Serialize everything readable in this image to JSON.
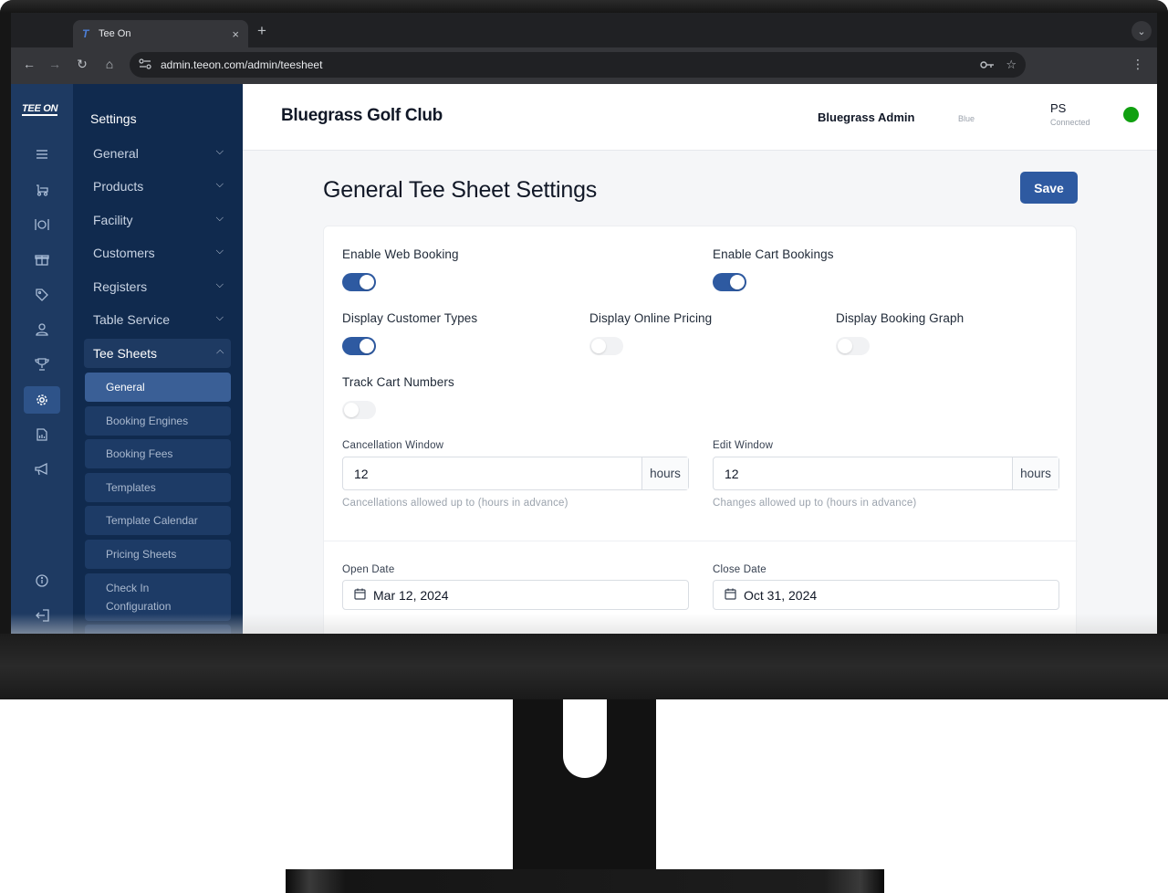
{
  "browser": {
    "tab_title": "Tee On",
    "tab_icon": "T",
    "tab_close": "×",
    "new_tab": "+",
    "tabs_menu": "⌄",
    "url": "admin.teeon.com/admin/teesheet",
    "back": "←",
    "forward": "→",
    "reload": "↻",
    "home": "⌂",
    "kebab": "⋮"
  },
  "rail": {
    "logo": "TEE ON",
    "icons": [
      "menu-icon",
      "golf-cart-icon",
      "dining-icon",
      "gift-icon",
      "tag-icon",
      "user-icon",
      "trophy-icon",
      "gear-icon",
      "document-icon",
      "megaphone-icon"
    ],
    "bottom_icons": [
      "info-icon",
      "logout-icon"
    ],
    "active_index": 7
  },
  "settings_nav": {
    "title": "Settings",
    "items": [
      {
        "label": "General"
      },
      {
        "label": "Products"
      },
      {
        "label": "Facility"
      },
      {
        "label": "Customers"
      },
      {
        "label": "Registers"
      },
      {
        "label": "Table Service"
      },
      {
        "label": "Tee Sheets"
      }
    ],
    "sub_items": [
      {
        "label": "General"
      },
      {
        "label": "Booking Engines"
      },
      {
        "label": "Booking Fees"
      },
      {
        "label": "Templates"
      },
      {
        "label": "Template Calendar"
      },
      {
        "label": "Pricing Sheets"
      },
      {
        "label": "Check In Configuration"
      }
    ]
  },
  "header": {
    "club_name": "Bluegrass Golf Club",
    "admin_name": "Bluegrass Admin",
    "admin_role": "Blue",
    "ps_label": "PS",
    "ps_status": "Connected",
    "status_color": "#10a010"
  },
  "page": {
    "title": "General Tee Sheet Settings",
    "save_label": "Save"
  },
  "toggles": {
    "web_booking": {
      "label": "Enable Web Booking",
      "on": true
    },
    "cart_bookings": {
      "label": "Enable Cart Bookings",
      "on": true
    },
    "customer_types": {
      "label": "Display Customer Types",
      "on": true
    },
    "online_pricing": {
      "label": "Display Online Pricing",
      "on": false
    },
    "booking_graph": {
      "label": "Display Booking Graph",
      "on": false
    },
    "cart_numbers": {
      "label": "Track Cart Numbers",
      "on": false
    }
  },
  "cancellation": {
    "label": "Cancellation Window",
    "value": "12",
    "unit": "hours",
    "helper": "Cancellations allowed up to (hours in advance)"
  },
  "edit_window": {
    "label": "Edit Window",
    "value": "12",
    "unit": "hours",
    "helper": "Changes allowed up to (hours in advance)"
  },
  "open_date": {
    "label": "Open Date",
    "value": "Mar 12, 2024"
  },
  "close_date": {
    "label": "Close Date",
    "value": "Oct 31, 2024"
  },
  "colors": {
    "rail_bg": "#1e3a62",
    "nav_bg": "#102a4e",
    "accent": "#2e5aa1"
  }
}
